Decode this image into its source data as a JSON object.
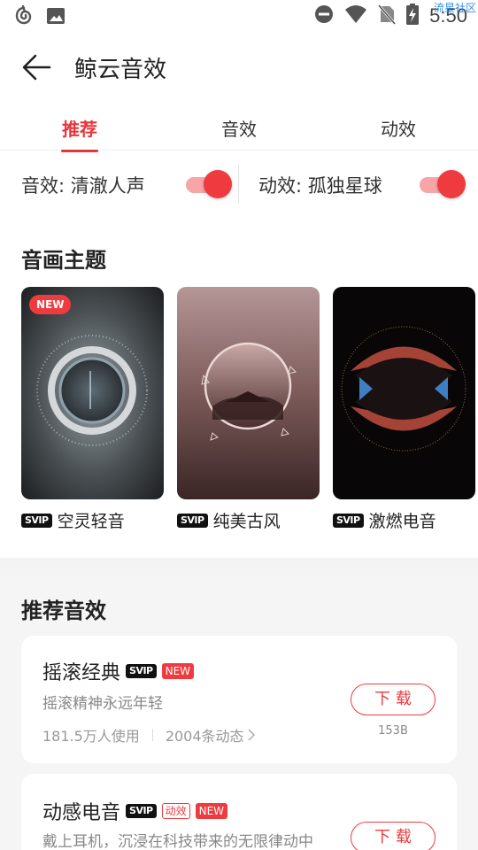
{
  "status_bar": {
    "time": "5:50",
    "watermark": "流星社区",
    "icons": [
      "netease-music-icon",
      "image-icon",
      "dnd-icon",
      "wifi-icon",
      "no-sim-icon",
      "battery-charging-icon"
    ]
  },
  "header": {
    "title": "鲸云音效"
  },
  "tabs": [
    {
      "label": "推荐",
      "active": true
    },
    {
      "label": "音效",
      "active": false
    },
    {
      "label": "动效",
      "active": false
    }
  ],
  "toggles": {
    "sound": {
      "label": "音效: 清澈人声",
      "on": true
    },
    "motion": {
      "label": "动效: 孤独星球",
      "on": true
    }
  },
  "themes": {
    "title": "音画主题",
    "badge": "NEW",
    "vip_label": "SVIP",
    "items": [
      {
        "name": "空灵轻音",
        "is_new": true
      },
      {
        "name": "纯美古风",
        "is_new": false
      },
      {
        "name": "激燃电音",
        "is_new": false
      }
    ]
  },
  "recommended": {
    "title": "推荐音效",
    "download_label": "下 载",
    "tag_new": "NEW",
    "tag_motion": "动效",
    "items": [
      {
        "name": "摇滚经典",
        "desc": "摇滚精神永远年轻",
        "users": "181.5万人使用",
        "posts": "2004条动态",
        "size": "153B"
      },
      {
        "name": "动感电音",
        "desc": "戴上耳机，沉浸在科技带来的无限律动中"
      }
    ]
  },
  "colors": {
    "accent": "#ef3b3f",
    "accent_light": "#f7a5a6",
    "background_gray": "#f5f5f5"
  }
}
